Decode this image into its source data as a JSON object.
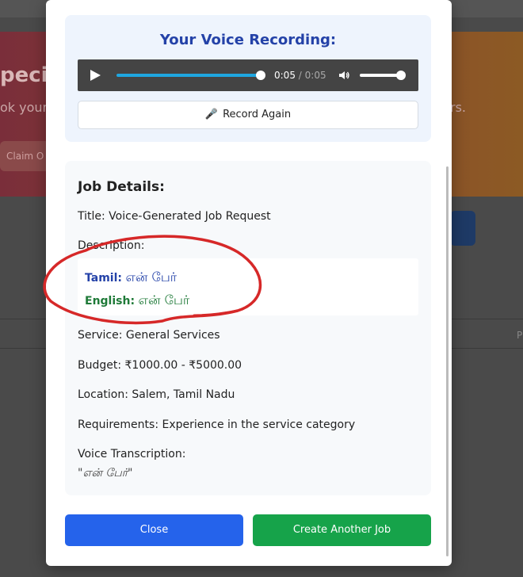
{
  "background": {
    "banner_title": "pecia",
    "banner_sub_left": "ok your",
    "banner_sub_right": "rs.",
    "claim_label": "Claim O",
    "row_text": "P"
  },
  "recording": {
    "title": "Your Voice Recording:",
    "audio": {
      "current": "0:05",
      "separator": "/",
      "duration": "0:05",
      "progress": 1.0,
      "volume": 1.0
    },
    "record_again": "Record Again",
    "mic_icon": "microphone-icon"
  },
  "job": {
    "heading": "Job Details:",
    "title_line": "Title: Voice-Generated Job Request",
    "description_label": "Description:",
    "description": {
      "tamil_label": "Tamil:",
      "tamil_value": "என் பேர்",
      "english_label": "English:",
      "english_value": "என் பேர்"
    },
    "service_line": "Service: General Services",
    "budget_line": "Budget: ₹1000.00 - ₹5000.00",
    "location_line": "Location: Salem, Tamil Nadu",
    "requirements_line": "Requirements: Experience in the service category",
    "transcription_label": "Voice Transcription:",
    "transcription_value": "\"என் பேர்\""
  },
  "actions": {
    "close": "Close",
    "create_another": "Create Another Job"
  },
  "colors": {
    "close_button": "#2563eb",
    "create_button": "#16a34a",
    "annotation": "#d62828"
  }
}
